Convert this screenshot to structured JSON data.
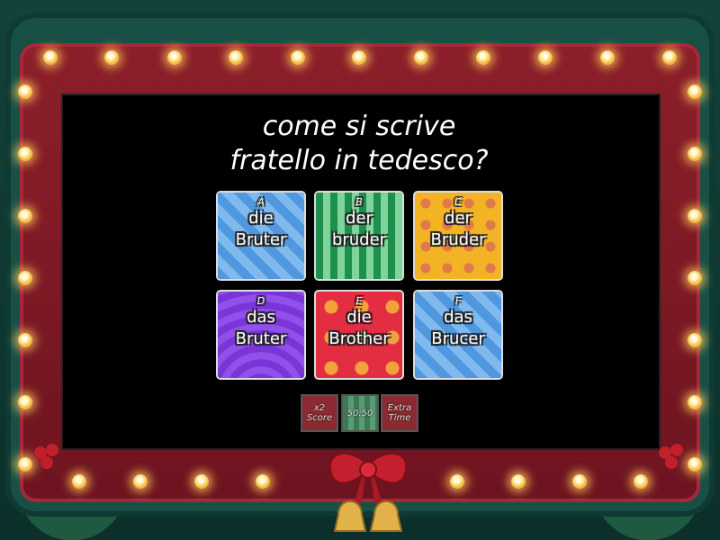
{
  "question": {
    "line1": "come si scrive",
    "line2": "fratello in tedesco?"
  },
  "answers": [
    {
      "letter": "A",
      "text": "die\nBruter",
      "pattern": "blue-stripes"
    },
    {
      "letter": "B",
      "text": "der\nbruder",
      "pattern": "green-stripes"
    },
    {
      "letter": "C",
      "text": "der\nBruder",
      "pattern": "yellow-dots"
    },
    {
      "letter": "D",
      "text": "das\nBruter",
      "pattern": "purple-waves"
    },
    {
      "letter": "E",
      "text": "die\nBrother",
      "pattern": "red-dots"
    },
    {
      "letter": "F",
      "text": "das\nBrucer",
      "pattern": "blue-stripes"
    }
  ],
  "powerups": [
    {
      "label": "x2\nScore"
    },
    {
      "label": "50:50"
    },
    {
      "label": "Extra\nTime"
    }
  ],
  "colors": {
    "frame_red": "#8c1f2a",
    "bulb": "#ffe38a",
    "screen": "#000000"
  }
}
